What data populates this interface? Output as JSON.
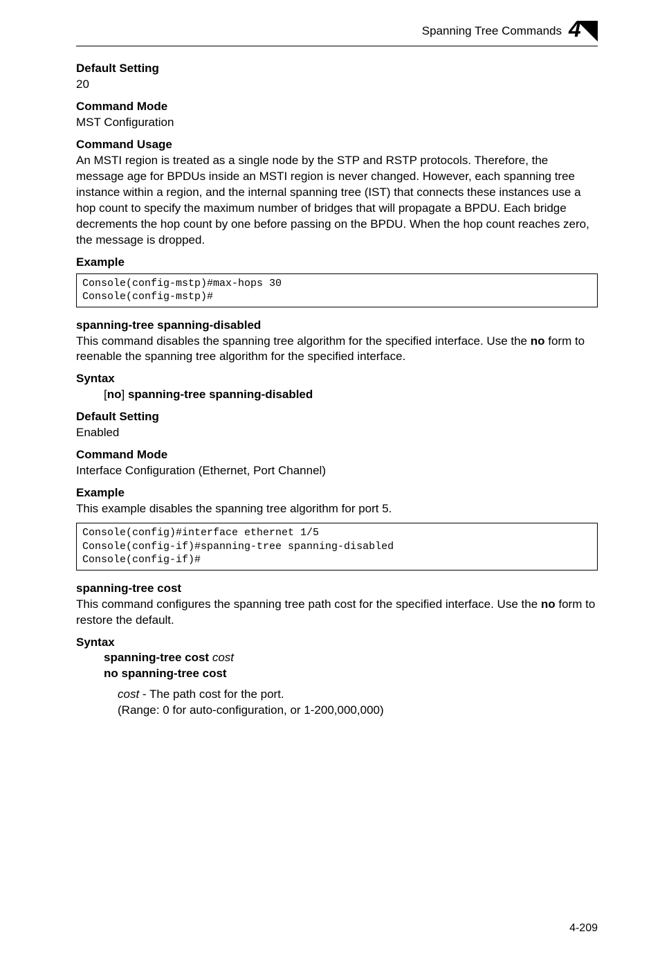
{
  "header": {
    "title": "Spanning Tree Commands",
    "badge_number": "4"
  },
  "sections": {
    "default_setting_1": {
      "heading": "Default Setting",
      "value": "20"
    },
    "command_mode_1": {
      "heading": "Command Mode",
      "value": "MST Configuration"
    },
    "command_usage": {
      "heading": "Command Usage",
      "body": "An MSTI region is treated as a single node by the STP and RSTP protocols. Therefore, the message age for BPDUs inside an MSTI region is never changed. However, each spanning tree instance within a region, and the internal spanning tree (IST) that connects these instances use a hop count to specify the maximum number of bridges that will propagate a BPDU. Each bridge decrements the hop count by one before passing on the BPDU. When the hop count reaches zero, the message is dropped."
    },
    "example_1": {
      "heading": "Example",
      "code": "Console(config-mstp)#max-hops 30\nConsole(config-mstp)#"
    },
    "span_disabled": {
      "heading": "spanning-tree spanning-disabled",
      "desc_pre": "This command disables the spanning tree algorithm for the specified interface. Use the ",
      "desc_bold": "no",
      "desc_post": " form to reenable the spanning tree algorithm for the specified interface."
    },
    "syntax_1": {
      "heading": "Syntax",
      "bracket_open": "[",
      "no": "no",
      "bracket_close": "] ",
      "cmd": "spanning-tree spanning-disabled"
    },
    "default_setting_2": {
      "heading": "Default Setting",
      "value": "Enabled"
    },
    "command_mode_2": {
      "heading": "Command Mode",
      "value": "Interface Configuration (Ethernet, Port Channel)"
    },
    "example_2": {
      "heading": "Example",
      "desc": "This example disables the spanning tree algorithm for port 5.",
      "code": "Console(config)#interface ethernet 1/5\nConsole(config-if)#spanning-tree spanning-disabled\nConsole(config-if)#"
    },
    "span_cost": {
      "heading": "spanning-tree cost",
      "desc_pre": "This command configures the spanning tree path cost for the specified interface. Use the ",
      "desc_bold": "no",
      "desc_post": " form to restore the default."
    },
    "syntax_2": {
      "heading": "Syntax",
      "line1_bold": "spanning-tree cost ",
      "line1_italic": "cost",
      "line2": "no spanning-tree cost",
      "param_italic": "cost",
      "param_desc": " - The path cost for the port.",
      "param_range": "(Range: 0 for auto-configuration, or 1-200,000,000)"
    }
  },
  "page_number": "4-209"
}
